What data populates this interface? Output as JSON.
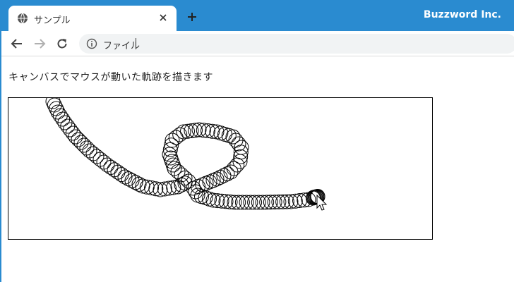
{
  "browser": {
    "tab_title": "サンプル",
    "brand": "Buzzword Inc.",
    "address_text": "ファイル"
  },
  "page": {
    "description": "キャンバスでマウスが動いた軌跡を描きます"
  },
  "colors": {
    "titlebar": "#2a8bd0",
    "stroke": "#000000"
  },
  "icons": {
    "favicon": "globe-icon",
    "close": "close-icon",
    "new_tab": "plus-icon",
    "back": "arrow-left-icon",
    "forward": "arrow-right-icon",
    "reload": "reload-icon",
    "info": "info-icon",
    "cursor": "mouse-pointer-icon"
  }
}
